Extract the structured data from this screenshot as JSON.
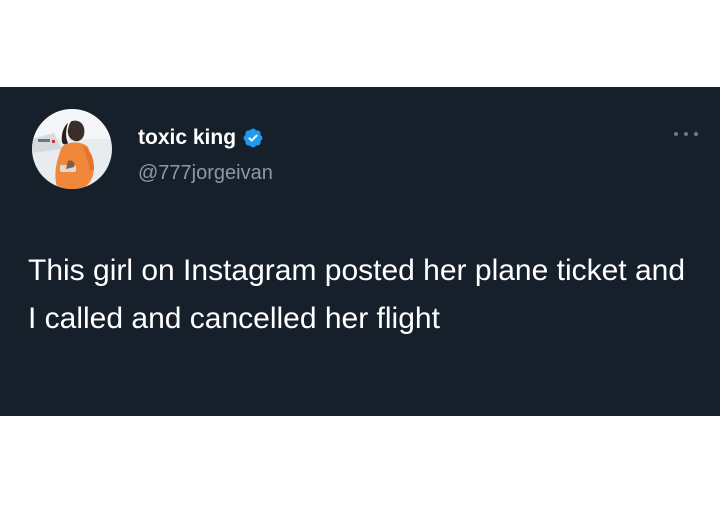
{
  "tweet": {
    "author": {
      "display_name": "toxic king",
      "handle": "@777jorgeivan",
      "verified": true,
      "verified_icon": "verified-badge-icon"
    },
    "text": "This girl on Instagram posted her plane ticket and I called and cancelled her flight",
    "more_icon": "more-options-icon"
  },
  "colors": {
    "card_background": "#15202b",
    "display_name": "#ffffff",
    "handle": "#8b98a5",
    "verified": "#1d9bf0",
    "text": "#ffffff"
  }
}
